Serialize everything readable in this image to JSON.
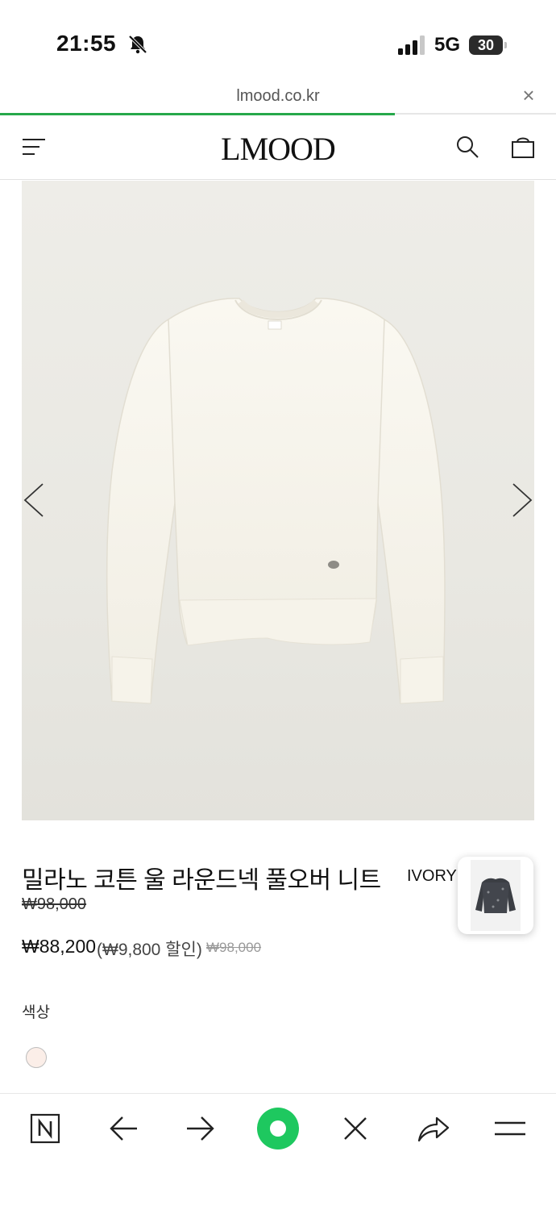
{
  "status_bar": {
    "time": "21:55",
    "network": "5G",
    "battery": "30"
  },
  "browser": {
    "url": "lmood.co.kr",
    "close_glyph": "×",
    "load_progress": 0.71
  },
  "header": {
    "logo": "LMOOD",
    "icons": [
      "menu-icon",
      "search-icon",
      "shopping-bag-icon"
    ]
  },
  "product": {
    "name": "밀라노 코튼 울 라운드넥 풀오버 니트",
    "color_tag": "IVORY",
    "original_price": "₩98,000",
    "sale_price": "₩88,200",
    "discount_note": "(₩9,800 할인)",
    "struck_price": "₩98,000",
    "color_label": "색상",
    "swatch_color": "#fbeee8"
  },
  "toolbar": {
    "items": [
      "naver-icon",
      "back-icon",
      "forward-icon",
      "home-icon",
      "close-icon",
      "share-icon",
      "menu-icon"
    ],
    "accent": "#1ec85f"
  }
}
